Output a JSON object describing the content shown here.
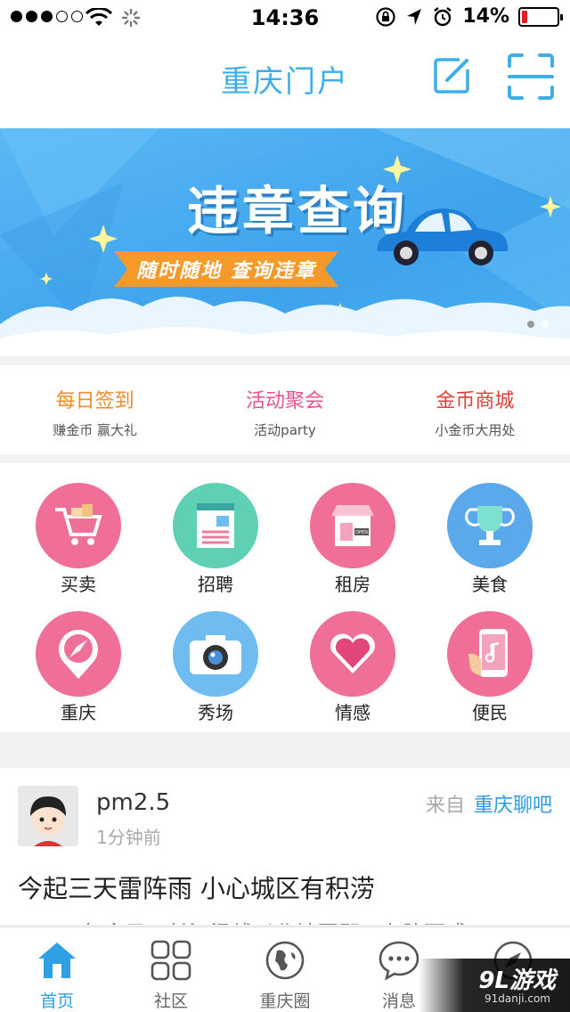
{
  "status_bar": {
    "time": "14:36",
    "battery_percent": "14%",
    "battery_level": 0.14,
    "signal_dots_filled": 3,
    "signal_dots_total": 5
  },
  "navbar": {
    "title": "重庆门户",
    "edit_icon": "edit-icon",
    "scan_icon": "scan-icon"
  },
  "banner": {
    "headline": "违章查询",
    "slogan": "随时随地  查询违章",
    "pager_total": 2,
    "pager_active": 1
  },
  "quick_links": [
    {
      "title": "每日签到",
      "subtitle": "赚金币 赢大礼",
      "color": "#f28a2e"
    },
    {
      "title": "活动聚会",
      "subtitle": "活动party",
      "color": "#e8548d"
    },
    {
      "title": "金币商城",
      "subtitle": "小金币大用处",
      "color": "#e0403a"
    }
  ],
  "grid": [
    {
      "label": "买卖",
      "icon": "cart-icon"
    },
    {
      "label": "招聘",
      "icon": "document-icon"
    },
    {
      "label": "租房",
      "icon": "shop-icon"
    },
    {
      "label": "美食",
      "icon": "trophy-icon"
    },
    {
      "label": "重庆",
      "icon": "compass-icon"
    },
    {
      "label": "秀场",
      "icon": "camera-icon"
    },
    {
      "label": "情感",
      "icon": "heart-icon"
    },
    {
      "label": "便民",
      "icon": "phone-icon"
    }
  ],
  "post": {
    "user": "pm2.5",
    "time": "1分钟前",
    "from_label": "来自",
    "from_source": "重庆聊吧",
    "headline": "今起三天雷阵雨 小心城区有积涝",
    "excerpt": "三三三年今日，长江汛线以北地区即三有阵雨或"
  },
  "tabbar": [
    {
      "label": "首页",
      "icon": "home-icon",
      "active": true
    },
    {
      "label": "社区",
      "icon": "grid-icon",
      "active": false
    },
    {
      "label": "重庆圈",
      "icon": "globe-icon",
      "active": false
    },
    {
      "label": "消息",
      "icon": "chat-icon",
      "active": false
    },
    {
      "label": "",
      "icon": "compass-icon",
      "active": false
    }
  ],
  "watermark": {
    "logo": "9L游戏",
    "site": "91danji.com"
  },
  "colors": {
    "accent": "#3eaee8",
    "pink": "#ef6f97",
    "teal": "#5fd0b3",
    "blue": "#5ba8ea"
  }
}
